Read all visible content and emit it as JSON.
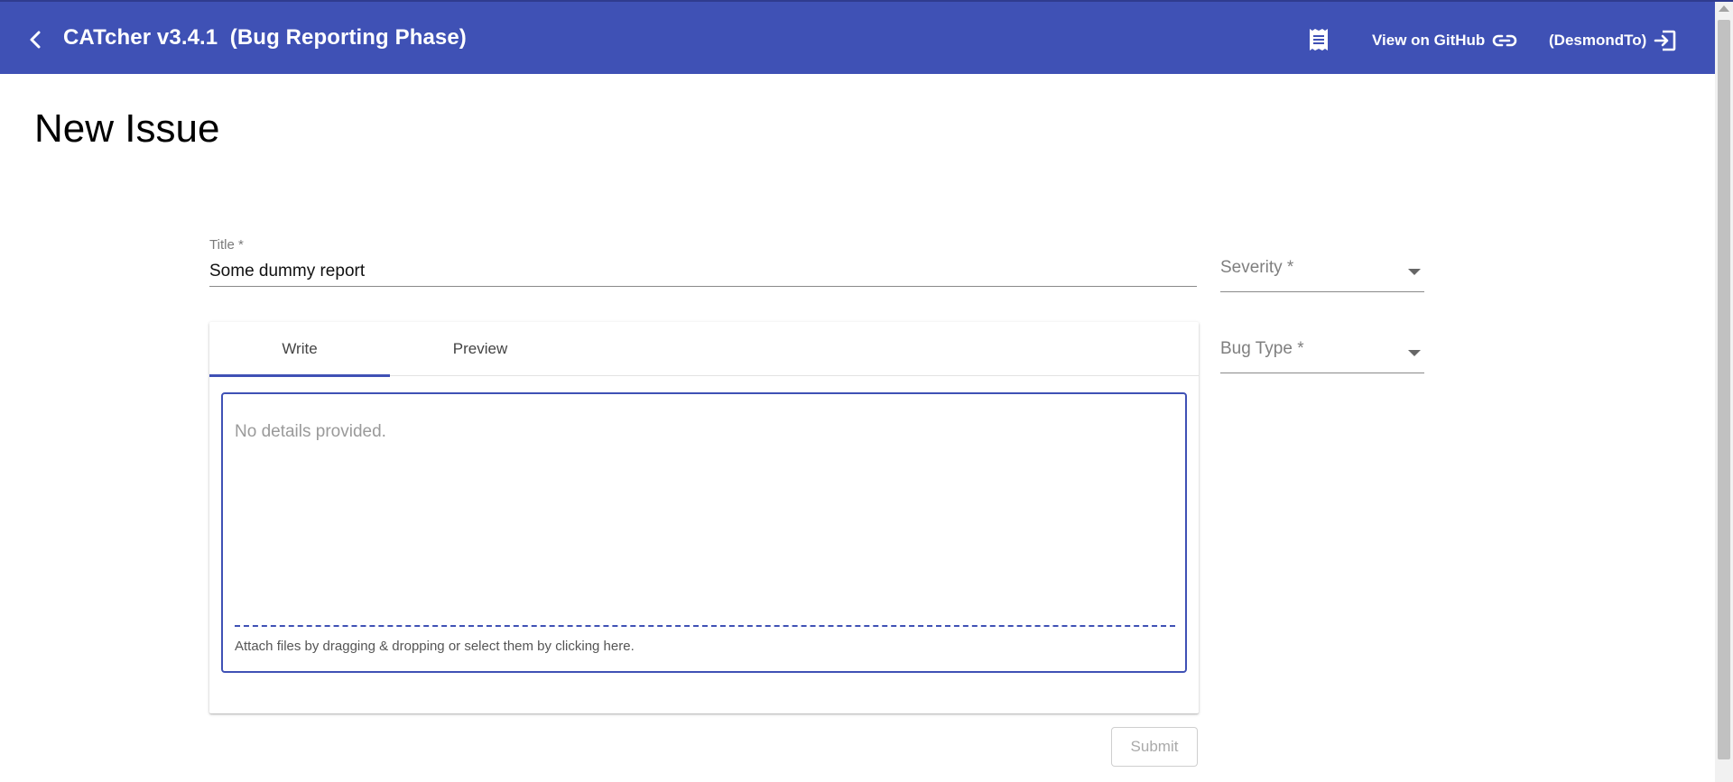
{
  "toolbar": {
    "title": "CATcher v3.4.1  (Bug Reporting Phase)",
    "github_label": "View on GitHub",
    "user_label": "(DesmondTo)",
    "background": "#3f51b5",
    "icons": {
      "back": "arrow-back-icon",
      "changelog": "receipt-icon",
      "github": "link-icon",
      "logout": "logout-icon"
    }
  },
  "page": {
    "title": "New Issue"
  },
  "form": {
    "title_label": "Title *",
    "title_value": "Some dummy report",
    "severity_label": "Severity *",
    "bug_type_label": "Bug Type *",
    "tabs": [
      {
        "label": "Write",
        "active": true
      },
      {
        "label": "Preview",
        "active": false
      }
    ],
    "description_placeholder": "No details provided.",
    "attach_hint": "Attach files by dragging & dropping or select them by clicking here.",
    "submit_label": "Submit",
    "submit_enabled": false,
    "accent": "#3f51b5"
  }
}
